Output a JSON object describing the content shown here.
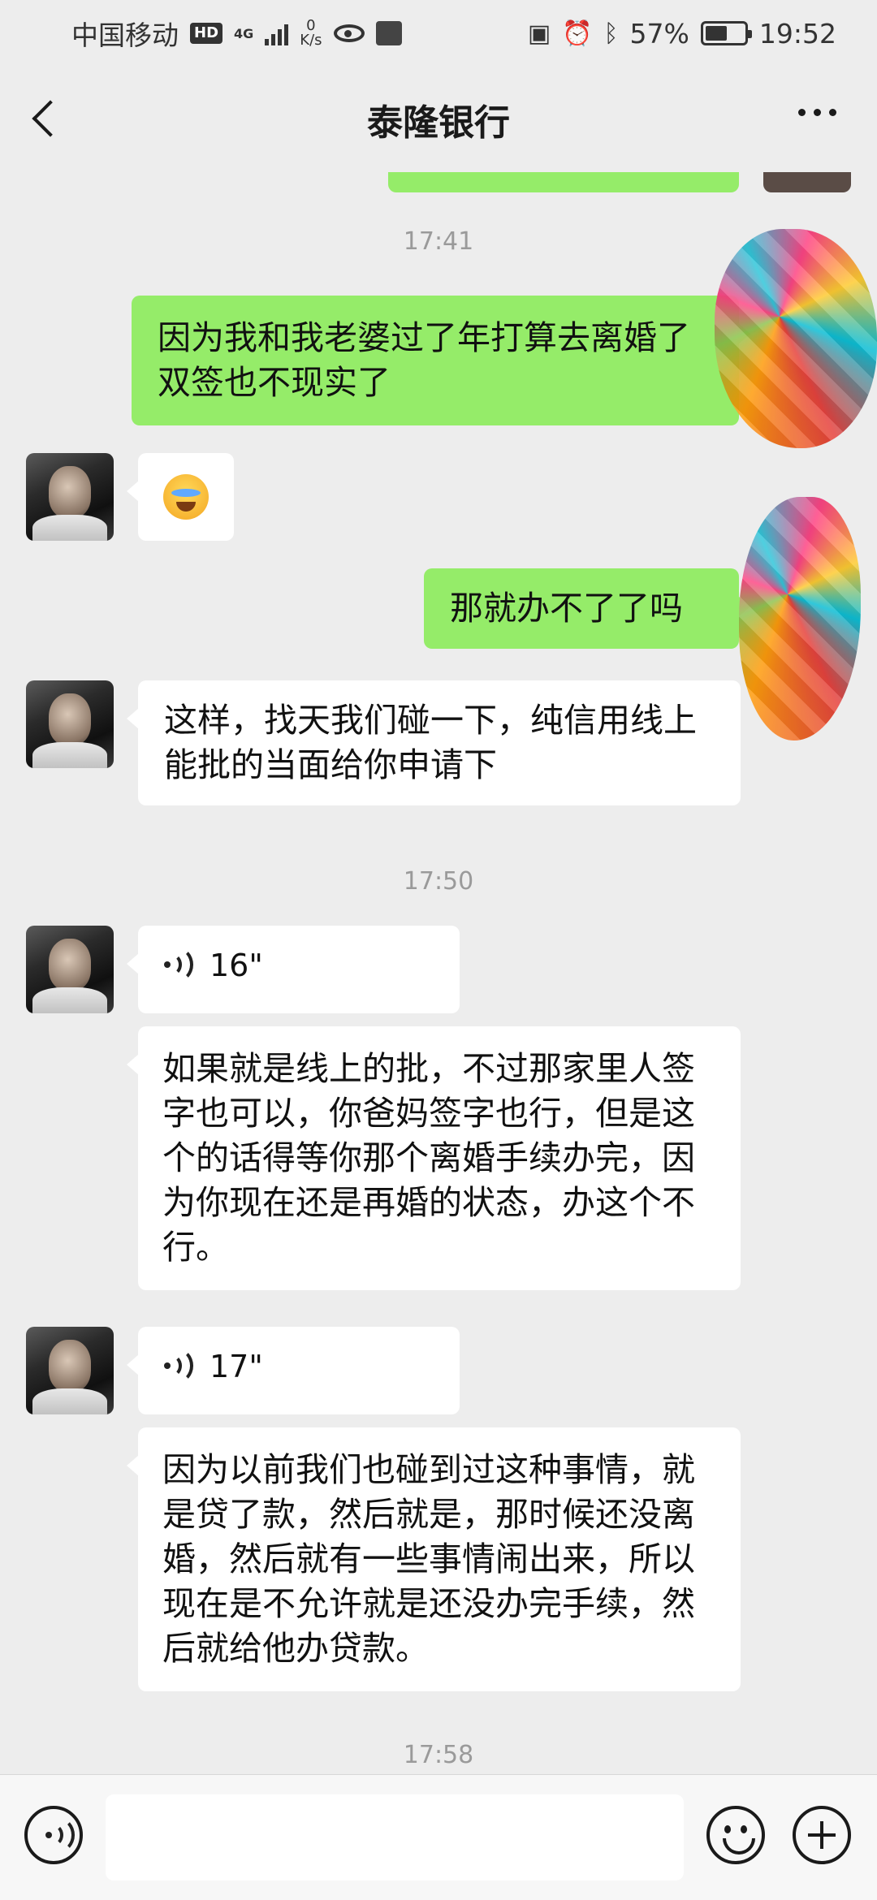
{
  "status_bar": {
    "carrier": "中国移动",
    "hd_badge": "HD",
    "network_type": "4G",
    "net_speed_value": "0",
    "net_speed_unit": "K/s",
    "battery_percent": "57%",
    "battery_level": 0.57,
    "time": "19:52",
    "icons": [
      "signal-icon",
      "eye-icon",
      "mailbox-icon",
      "nfc-icon",
      "alarm-icon",
      "bluetooth-icon",
      "battery-icon"
    ]
  },
  "header": {
    "title": "泰隆银行",
    "back_icon": "chevron-left-icon",
    "more_icon": "more-dots-icon"
  },
  "messages": [
    {
      "type": "timestamp",
      "text": "17:41"
    },
    {
      "type": "text",
      "sender": "me",
      "text": "因为我和我老婆过了年打算去离婚了  双签也不现实了"
    },
    {
      "type": "emoji",
      "sender": "them",
      "emoji": "crying-face-emoji"
    },
    {
      "type": "text",
      "sender": "me",
      "text": "那就办不了了吗"
    },
    {
      "type": "text",
      "sender": "them",
      "text": "这样，找天我们碰一下，纯信用线上能批的当面给你申请下"
    },
    {
      "type": "timestamp",
      "text": "17:50"
    },
    {
      "type": "voice",
      "sender": "them",
      "duration": "16\""
    },
    {
      "type": "text",
      "sender": "them",
      "text": "如果就是线上的批，不过那家里人签字也可以，你爸妈签字也行，但是这个的话得等你那个离婚手续办完，因为你现在还是再婚的状态，办这个不行。"
    },
    {
      "type": "voice",
      "sender": "them",
      "duration": "17\""
    },
    {
      "type": "text",
      "sender": "them",
      "text": "因为以前我们也碰到过这种事情，就是贷了款，然后就是，那时候还没离婚，然后就有一些事情闹出来，所以现在是不允许就是还没办完手续，然后就给他办贷款。"
    },
    {
      "type": "timestamp",
      "text": "17:58"
    }
  ],
  "input_bar": {
    "voice_icon": "voice-input-icon",
    "text_value": "",
    "emoji_icon": "emoji-icon",
    "plus_icon": "plus-icon"
  },
  "colors": {
    "background": "#ededed",
    "my_bubble": "#95ec69",
    "their_bubble": "#ffffff",
    "timestamp": "#9a9a9a"
  }
}
